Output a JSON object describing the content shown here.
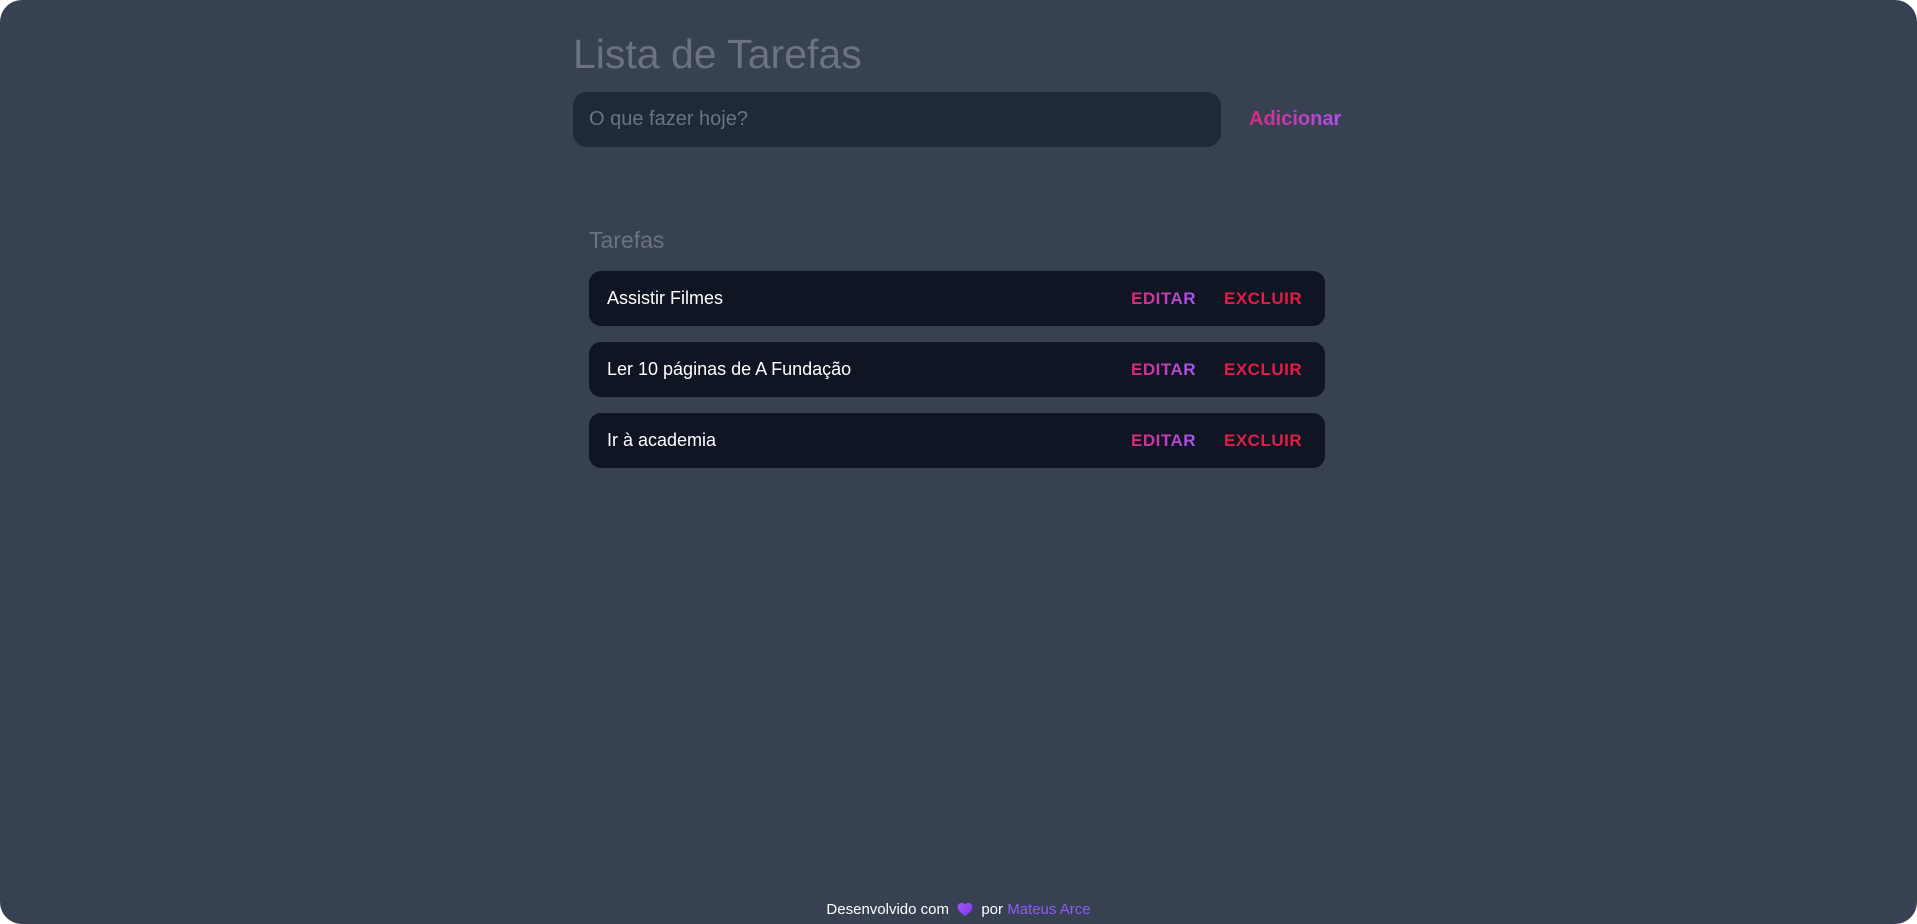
{
  "header": {
    "title": "Lista de Tarefas"
  },
  "form": {
    "input_value": "",
    "input_placeholder": "O que fazer hoje?",
    "add_label": "Adicionar"
  },
  "tasks": {
    "section_title": "Tarefas",
    "edit_label": "EDITAR",
    "delete_label": "EXCLUIR",
    "items": [
      {
        "text": "Assistir Filmes"
      },
      {
        "text": "Ler 10 páginas de A Fundação"
      },
      {
        "text": "Ir à academia"
      }
    ]
  },
  "footer": {
    "prefix": "Desenvolvido com",
    "icon": "heart-icon",
    "middle": "por",
    "author": "Mateus Arce"
  },
  "colors": {
    "background": "#374151",
    "input_background": "#1f2937",
    "task_background": "#0f1523",
    "accent_gradient_start": "#db2777",
    "accent_gradient_end": "#a855f7",
    "delete": "#e11d48",
    "link": "#8b5cf6",
    "muted_text": "#6b7280"
  }
}
